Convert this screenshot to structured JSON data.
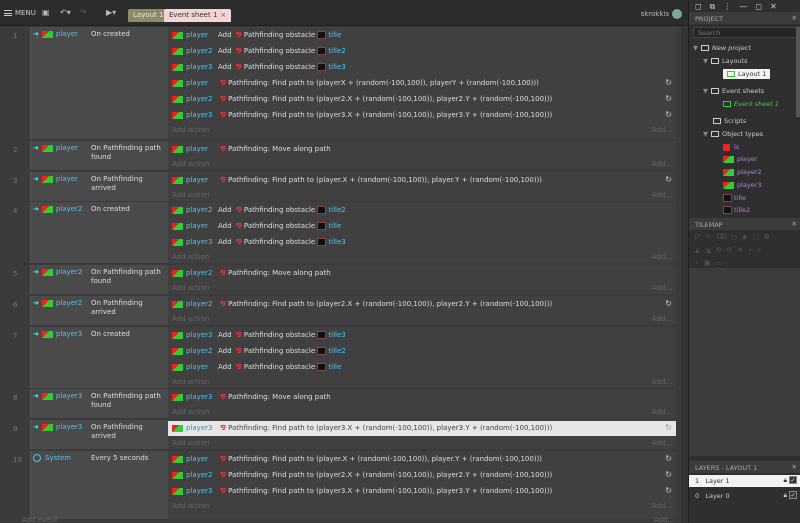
{
  "topbar": {
    "menu_label": "MENU",
    "layout_tab": "Layout 1",
    "event_tab": "Event sheet 1",
    "close_tab": "×",
    "username": "skrokkis"
  },
  "events": [
    {
      "num": "1",
      "object": "player",
      "condition": "On created",
      "actions": [
        {
          "object": "player",
          "text": "Add",
          "pf": "Pathfinding obstacle",
          "tile": "tille"
        },
        {
          "object": "player2",
          "text": "Add",
          "pf": "Pathfinding obstacle",
          "tile": "tille2"
        },
        {
          "object": "player3",
          "text": "Add",
          "pf": "Pathfinding obstacle",
          "tile": "tille3"
        },
        {
          "object": "player",
          "text": "Pathfinding: Find path to (playerX + (random(-100,100)), playerY + (random(-100,100)))"
        },
        {
          "object": "player2",
          "text": "Pathfinding: Find path to (player2.X + (random(-100,100)), player2.Y + (random(-100,100)))"
        },
        {
          "object": "player3",
          "text": "Pathfinding: Find path to (player3.X + (random(-100,100)), player3.Y + (random(-100,100)))"
        }
      ]
    },
    {
      "num": "2",
      "object": "player",
      "condition": "On Pathfinding path found",
      "actions": [
        {
          "object": "player",
          "text": "Pathfinding: Move along path"
        }
      ]
    },
    {
      "num": "3",
      "object": "player",
      "condition": "On Pathfinding arrived",
      "actions": [
        {
          "object": "player",
          "text": "Pathfinding: Find path to (player.X + (random(-100,100)), player.Y + (random(-100,100)))"
        }
      ]
    },
    {
      "num": "4",
      "object": "player2",
      "condition": "On created",
      "actions": [
        {
          "object": "player2",
          "text": "Add",
          "pf": "Pathfinding obstacle",
          "tile": "tille2"
        },
        {
          "object": "player",
          "text": "Add",
          "pf": "Pathfinding obstacle",
          "tile": "tille"
        },
        {
          "object": "player3",
          "text": "Add",
          "pf": "Pathfinding obstacle",
          "tile": "tille3"
        }
      ]
    },
    {
      "num": "5",
      "object": "player2",
      "condition": "On Pathfinding path found",
      "actions": [
        {
          "object": "player2",
          "text": "Pathfinding: Move along path"
        }
      ]
    },
    {
      "num": "6",
      "object": "player2",
      "condition": "On Pathfinding arrived",
      "actions": [
        {
          "object": "player2",
          "text": "Pathfinding: Find path to (player2.X + (random(-100,100)), player2.Y + (random(-100,100)))"
        }
      ]
    },
    {
      "num": "7",
      "object": "player3",
      "condition": "On created",
      "actions": [
        {
          "object": "player3",
          "text": "Add",
          "pf": "Pathfinding obstacle",
          "tile": "tille3"
        },
        {
          "object": "player2",
          "text": "Add",
          "pf": "Pathfinding obstacle",
          "tile": "tille2"
        },
        {
          "object": "player",
          "text": "Add",
          "pf": "Pathfinding obstacle",
          "tile": "tille"
        }
      ]
    },
    {
      "num": "8",
      "object": "player3",
      "condition": "On Pathfinding path found",
      "actions": [
        {
          "object": "player3",
          "text": "Pathfinding: Move along path"
        }
      ]
    },
    {
      "num": "9",
      "object": "player3",
      "condition": "On Pathfinding arrived",
      "actions": [
        {
          "object": "player3",
          "text": "Pathfinding: Find path to (player3.X + (random(-100,100)), player3.Y + (random(-100,100)))"
        }
      ]
    },
    {
      "num": "10",
      "object": "System",
      "condition": "Every 5 seconds",
      "actions": [
        {
          "object": "player",
          "text": "Pathfinding: Find path to (player.X + (random(-100,100)), player.Y + (random(-100,100)))"
        },
        {
          "object": "player2",
          "text": "Pathfinding: Find path to (player2.X + (random(-100,100)), player2.Y + (random(-100,100)))"
        },
        {
          "object": "player3",
          "text": "Pathfinding: Find path to (player3.X + (random(-100,100)), player3.Y + (random(-100,100)))"
        }
      ]
    }
  ],
  "add_action": "Add action",
  "add_dots": "Add...",
  "add_event": "Add event",
  "project": {
    "header": "PROJECT",
    "search_placeholder": "Search",
    "new_project": "New project",
    "layouts": "Layouts",
    "layout1": "Layout 1",
    "event_sheets": "Event sheets",
    "event_sheet1": "Event sheet 1",
    "scripts": "Scripts",
    "object_types": "Object types",
    "objects": [
      "ls",
      "player",
      "player2",
      "player3",
      "tille",
      "tille2"
    ]
  },
  "tilemap": {
    "header": "TILEMAP"
  },
  "layers": {
    "header": "LAYERS - LAYOUT 1",
    "items": [
      {
        "num": "1",
        "name": "Layer 1"
      },
      {
        "num": "0",
        "name": "Layer 0"
      }
    ]
  }
}
